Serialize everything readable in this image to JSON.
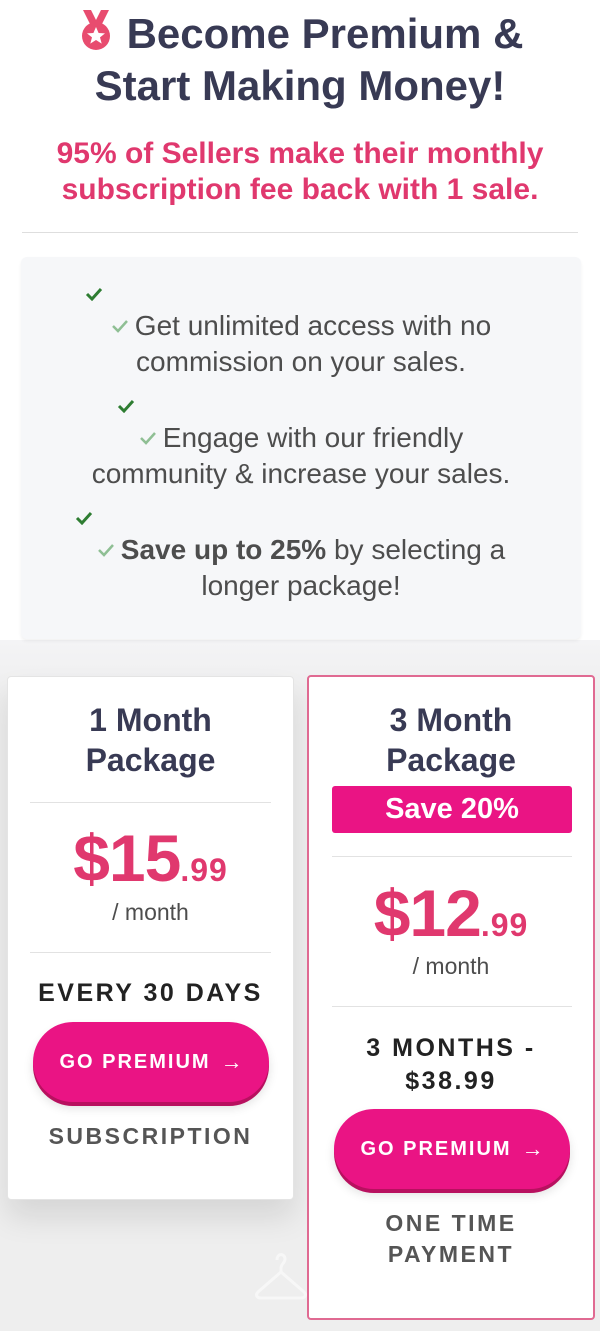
{
  "header": {
    "title_line1": "Become Premium &",
    "title_line2": "Start Making Money!",
    "subtitle_line1": "95% of Sellers make their monthly",
    "subtitle_line2": "subscription fee back with 1 sale."
  },
  "benefits": [
    {
      "line1": "Get unlimited access with no",
      "line2": "commission on your sales."
    },
    {
      "line1": "Engage with our friendly",
      "line2": "community & increase your sales."
    },
    {
      "bold": "Save up to 25%",
      "line1_rest": " by selecting a",
      "line2": "longer package!"
    }
  ],
  "packages": [
    {
      "title_line1": "1 Month",
      "title_line2": "Package",
      "price_dollars": "$15",
      "price_cents": ".99",
      "per": "/ month",
      "term_line1": "EVERY 30 DAYS",
      "cta": "GO PREMIUM",
      "cta_arrow": "→",
      "note_line1": "SUBSCRIPTION"
    },
    {
      "title_line1": "3 Month",
      "title_line2": "Package",
      "badge": "Save 20%",
      "price_dollars": "$12",
      "price_cents": ".99",
      "per": "/ month",
      "term_line1": "3 MONTHS -",
      "term_line2": "$38.99",
      "cta": "GO PREMIUM",
      "cta_arrow": "→",
      "note_line1": "ONE TIME",
      "note_line2": "PAYMENT"
    }
  ],
  "icons": {
    "medal": "medal-icon",
    "check": "check-icon",
    "arrow": "arrow-right-icon",
    "hanger": "hanger-icon"
  },
  "colors": {
    "heading": "#383a54",
    "accent": "#e0386e",
    "button": "#ea1484",
    "check_dark": "#2e7d32",
    "check_light": "#8fbf94"
  }
}
